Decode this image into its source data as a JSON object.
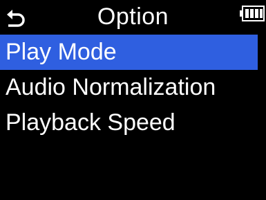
{
  "header": {
    "title": "Option",
    "back_icon": "return-arrow-icon",
    "battery_icon": "battery-full-icon",
    "battery_level": 1.0
  },
  "menu": {
    "selected_index": 0,
    "items": [
      {
        "label": "Play Mode"
      },
      {
        "label": "Audio Normalization"
      },
      {
        "label": "Playback Speed"
      }
    ]
  },
  "colors": {
    "background": "#000000",
    "text": "#ffffff",
    "selection": "#2f5fe0"
  }
}
